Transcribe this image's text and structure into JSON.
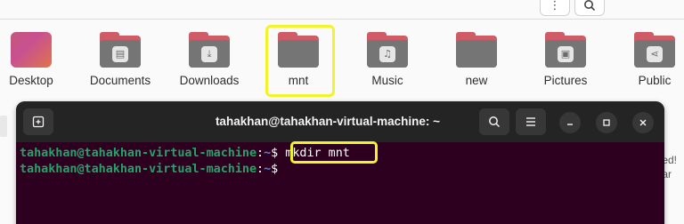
{
  "files_window": {
    "toolbar": {
      "menu_icon": "kebab-menu-icon",
      "search_icon": "search-icon"
    },
    "items": [
      {
        "label": "Desktop",
        "type": "desktop",
        "glyph": ""
      },
      {
        "label": "Documents",
        "type": "folder",
        "glyph": "▤"
      },
      {
        "label": "Downloads",
        "type": "folder",
        "glyph": "⤓"
      },
      {
        "label": "mnt",
        "type": "folder",
        "glyph": ""
      },
      {
        "label": "Music",
        "type": "folder",
        "glyph": "♫"
      },
      {
        "label": "new",
        "type": "folder",
        "glyph": ""
      },
      {
        "label": "Pictures",
        "type": "folder",
        "glyph": "▣"
      },
      {
        "label": "Public",
        "type": "folder",
        "glyph": "⋖"
      }
    ],
    "partial_right_text": [
      "ted!",
      "tar"
    ]
  },
  "terminal": {
    "title": "tahakhan@tahakhan-virtual-machine: ~",
    "lines": [
      {
        "user_host": "tahakhan@tahakhan-virtual-machine",
        "sep": ":",
        "path": "~",
        "dollar": "$ ",
        "command": "mkdir mnt"
      },
      {
        "user_host": "tahakhan@tahakhan-virtual-machine",
        "sep": ":",
        "path": "~",
        "dollar": "$ ",
        "command": ""
      }
    ],
    "buttons": {
      "new_tab_icon": "new-tab-icon",
      "search_icon": "search-icon",
      "menu_icon": "hamburger-menu-icon",
      "minimize_icon": "minimize-icon",
      "maximize_icon": "maximize-icon",
      "close_icon": "close-icon"
    }
  },
  "colors": {
    "terminal_bg": "#2c001e",
    "header_bg": "#242424",
    "prompt_user": "#26a269",
    "prompt_path": "#5b7fd8",
    "highlight": "#f3f32b",
    "folder_back": "#cf5b67",
    "folder_front": "#757575"
  }
}
